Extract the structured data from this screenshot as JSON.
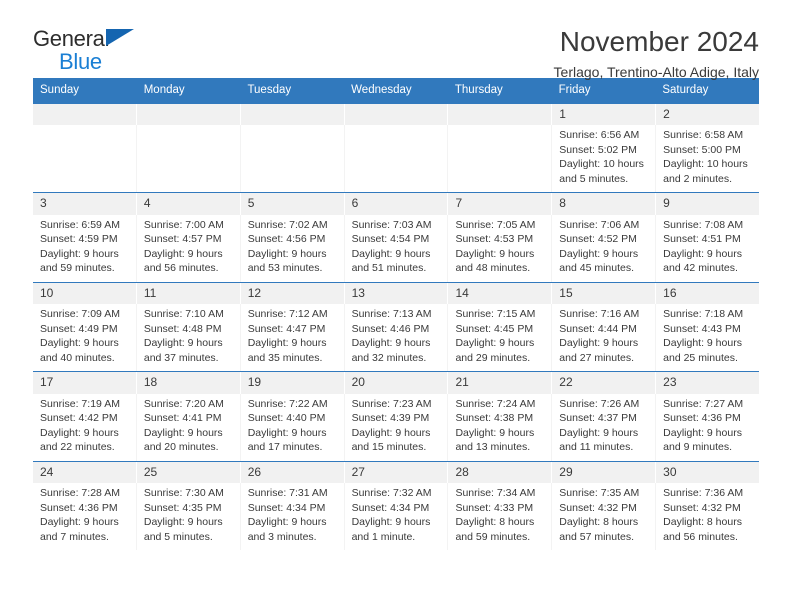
{
  "brand": {
    "name_top": "General",
    "name_bottom": "Blue",
    "accent_color": "#1a7fd4",
    "triangle_color": "#1565b0"
  },
  "header": {
    "title": "November 2024",
    "subtitle": "Terlago, Trentino-Alto Adige, Italy"
  },
  "theme": {
    "header_blue": "#3179bd",
    "daynum_band": "#f1f1f1",
    "text": "#3a3a3a"
  },
  "calendar": {
    "day_headers": [
      "Sunday",
      "Monday",
      "Tuesday",
      "Wednesday",
      "Thursday",
      "Friday",
      "Saturday"
    ],
    "weeks": [
      [
        {
          "day": "",
          "sunrise": "",
          "sunset": "",
          "daylight_1": "",
          "daylight_2": ""
        },
        {
          "day": "",
          "sunrise": "",
          "sunset": "",
          "daylight_1": "",
          "daylight_2": ""
        },
        {
          "day": "",
          "sunrise": "",
          "sunset": "",
          "daylight_1": "",
          "daylight_2": ""
        },
        {
          "day": "",
          "sunrise": "",
          "sunset": "",
          "daylight_1": "",
          "daylight_2": ""
        },
        {
          "day": "",
          "sunrise": "",
          "sunset": "",
          "daylight_1": "",
          "daylight_2": ""
        },
        {
          "day": "1",
          "sunrise": "Sunrise: 6:56 AM",
          "sunset": "Sunset: 5:02 PM",
          "daylight_1": "Daylight: 10 hours",
          "daylight_2": "and 5 minutes."
        },
        {
          "day": "2",
          "sunrise": "Sunrise: 6:58 AM",
          "sunset": "Sunset: 5:00 PM",
          "daylight_1": "Daylight: 10 hours",
          "daylight_2": "and 2 minutes."
        }
      ],
      [
        {
          "day": "3",
          "sunrise": "Sunrise: 6:59 AM",
          "sunset": "Sunset: 4:59 PM",
          "daylight_1": "Daylight: 9 hours",
          "daylight_2": "and 59 minutes."
        },
        {
          "day": "4",
          "sunrise": "Sunrise: 7:00 AM",
          "sunset": "Sunset: 4:57 PM",
          "daylight_1": "Daylight: 9 hours",
          "daylight_2": "and 56 minutes."
        },
        {
          "day": "5",
          "sunrise": "Sunrise: 7:02 AM",
          "sunset": "Sunset: 4:56 PM",
          "daylight_1": "Daylight: 9 hours",
          "daylight_2": "and 53 minutes."
        },
        {
          "day": "6",
          "sunrise": "Sunrise: 7:03 AM",
          "sunset": "Sunset: 4:54 PM",
          "daylight_1": "Daylight: 9 hours",
          "daylight_2": "and 51 minutes."
        },
        {
          "day": "7",
          "sunrise": "Sunrise: 7:05 AM",
          "sunset": "Sunset: 4:53 PM",
          "daylight_1": "Daylight: 9 hours",
          "daylight_2": "and 48 minutes."
        },
        {
          "day": "8",
          "sunrise": "Sunrise: 7:06 AM",
          "sunset": "Sunset: 4:52 PM",
          "daylight_1": "Daylight: 9 hours",
          "daylight_2": "and 45 minutes."
        },
        {
          "day": "9",
          "sunrise": "Sunrise: 7:08 AM",
          "sunset": "Sunset: 4:51 PM",
          "daylight_1": "Daylight: 9 hours",
          "daylight_2": "and 42 minutes."
        }
      ],
      [
        {
          "day": "10",
          "sunrise": "Sunrise: 7:09 AM",
          "sunset": "Sunset: 4:49 PM",
          "daylight_1": "Daylight: 9 hours",
          "daylight_2": "and 40 minutes."
        },
        {
          "day": "11",
          "sunrise": "Sunrise: 7:10 AM",
          "sunset": "Sunset: 4:48 PM",
          "daylight_1": "Daylight: 9 hours",
          "daylight_2": "and 37 minutes."
        },
        {
          "day": "12",
          "sunrise": "Sunrise: 7:12 AM",
          "sunset": "Sunset: 4:47 PM",
          "daylight_1": "Daylight: 9 hours",
          "daylight_2": "and 35 minutes."
        },
        {
          "day": "13",
          "sunrise": "Sunrise: 7:13 AM",
          "sunset": "Sunset: 4:46 PM",
          "daylight_1": "Daylight: 9 hours",
          "daylight_2": "and 32 minutes."
        },
        {
          "day": "14",
          "sunrise": "Sunrise: 7:15 AM",
          "sunset": "Sunset: 4:45 PM",
          "daylight_1": "Daylight: 9 hours",
          "daylight_2": "and 29 minutes."
        },
        {
          "day": "15",
          "sunrise": "Sunrise: 7:16 AM",
          "sunset": "Sunset: 4:44 PM",
          "daylight_1": "Daylight: 9 hours",
          "daylight_2": "and 27 minutes."
        },
        {
          "day": "16",
          "sunrise": "Sunrise: 7:18 AM",
          "sunset": "Sunset: 4:43 PM",
          "daylight_1": "Daylight: 9 hours",
          "daylight_2": "and 25 minutes."
        }
      ],
      [
        {
          "day": "17",
          "sunrise": "Sunrise: 7:19 AM",
          "sunset": "Sunset: 4:42 PM",
          "daylight_1": "Daylight: 9 hours",
          "daylight_2": "and 22 minutes."
        },
        {
          "day": "18",
          "sunrise": "Sunrise: 7:20 AM",
          "sunset": "Sunset: 4:41 PM",
          "daylight_1": "Daylight: 9 hours",
          "daylight_2": "and 20 minutes."
        },
        {
          "day": "19",
          "sunrise": "Sunrise: 7:22 AM",
          "sunset": "Sunset: 4:40 PM",
          "daylight_1": "Daylight: 9 hours",
          "daylight_2": "and 17 minutes."
        },
        {
          "day": "20",
          "sunrise": "Sunrise: 7:23 AM",
          "sunset": "Sunset: 4:39 PM",
          "daylight_1": "Daylight: 9 hours",
          "daylight_2": "and 15 minutes."
        },
        {
          "day": "21",
          "sunrise": "Sunrise: 7:24 AM",
          "sunset": "Sunset: 4:38 PM",
          "daylight_1": "Daylight: 9 hours",
          "daylight_2": "and 13 minutes."
        },
        {
          "day": "22",
          "sunrise": "Sunrise: 7:26 AM",
          "sunset": "Sunset: 4:37 PM",
          "daylight_1": "Daylight: 9 hours",
          "daylight_2": "and 11 minutes."
        },
        {
          "day": "23",
          "sunrise": "Sunrise: 7:27 AM",
          "sunset": "Sunset: 4:36 PM",
          "daylight_1": "Daylight: 9 hours",
          "daylight_2": "and 9 minutes."
        }
      ],
      [
        {
          "day": "24",
          "sunrise": "Sunrise: 7:28 AM",
          "sunset": "Sunset: 4:36 PM",
          "daylight_1": "Daylight: 9 hours",
          "daylight_2": "and 7 minutes."
        },
        {
          "day": "25",
          "sunrise": "Sunrise: 7:30 AM",
          "sunset": "Sunset: 4:35 PM",
          "daylight_1": "Daylight: 9 hours",
          "daylight_2": "and 5 minutes."
        },
        {
          "day": "26",
          "sunrise": "Sunrise: 7:31 AM",
          "sunset": "Sunset: 4:34 PM",
          "daylight_1": "Daylight: 9 hours",
          "daylight_2": "and 3 minutes."
        },
        {
          "day": "27",
          "sunrise": "Sunrise: 7:32 AM",
          "sunset": "Sunset: 4:34 PM",
          "daylight_1": "Daylight: 9 hours",
          "daylight_2": "and 1 minute."
        },
        {
          "day": "28",
          "sunrise": "Sunrise: 7:34 AM",
          "sunset": "Sunset: 4:33 PM",
          "daylight_1": "Daylight: 8 hours",
          "daylight_2": "and 59 minutes."
        },
        {
          "day": "29",
          "sunrise": "Sunrise: 7:35 AM",
          "sunset": "Sunset: 4:32 PM",
          "daylight_1": "Daylight: 8 hours",
          "daylight_2": "and 57 minutes."
        },
        {
          "day": "30",
          "sunrise": "Sunrise: 7:36 AM",
          "sunset": "Sunset: 4:32 PM",
          "daylight_1": "Daylight: 8 hours",
          "daylight_2": "and 56 minutes."
        }
      ]
    ]
  }
}
